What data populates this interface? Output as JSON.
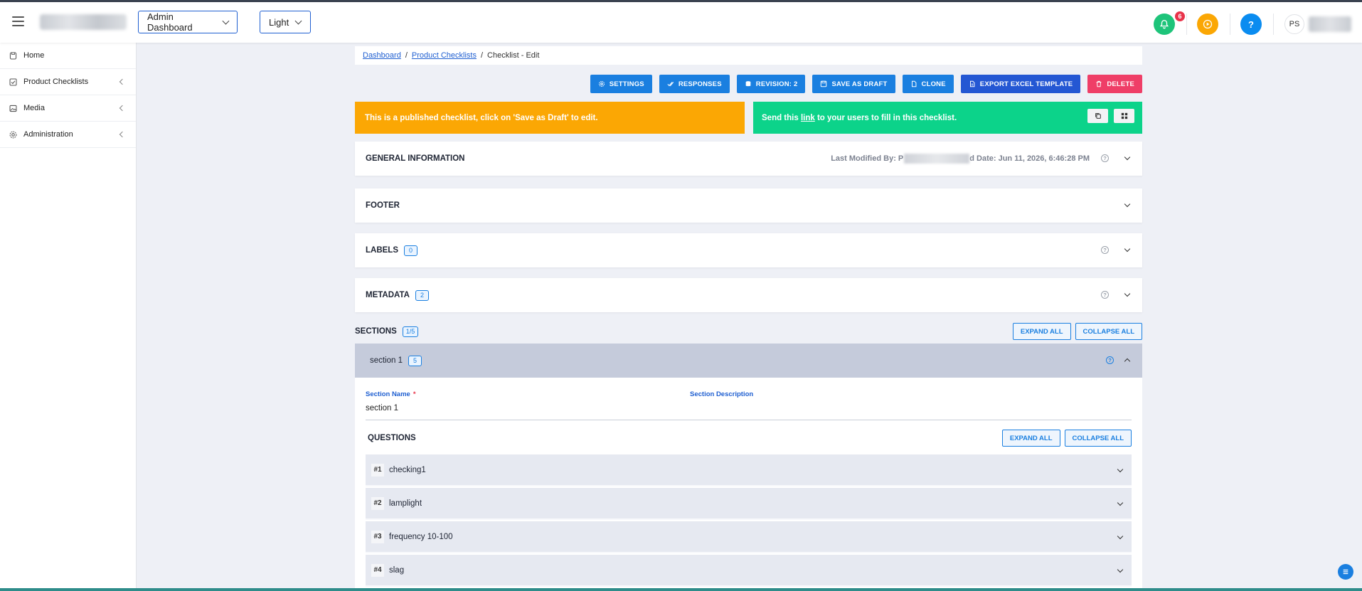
{
  "header": {
    "dashboard_select": "Admin Dashboard",
    "theme_select": "Light",
    "notification_count": "6",
    "help_label": "?",
    "avatar_initials": "PS"
  },
  "sidebar": {
    "items": [
      {
        "label": "Home",
        "icon": "home-icon"
      },
      {
        "label": "Product Checklists",
        "icon": "checklist-icon"
      },
      {
        "label": "Media",
        "icon": "image-icon"
      },
      {
        "label": "Administration",
        "icon": "gear-icon"
      }
    ]
  },
  "breadcrumb": {
    "item1": "Dashboard",
    "item2": "Product Checklists",
    "current": "Checklist - Edit",
    "separator": "/"
  },
  "toolbar": {
    "settings": "Settings",
    "responses": "Responses",
    "revision": "Revision: 2",
    "save_as_draft": "Save as draft",
    "clone": "Clone",
    "export": "Export Excel Template",
    "delete": "Delete"
  },
  "alerts": {
    "published": "This is a published checklist, click on 'Save as Draft' to edit.",
    "share_prefix": "Send this ",
    "share_link": "link",
    "share_suffix": " to your users to fill in this checklist."
  },
  "panels": {
    "general": "GENERAL INFORMATION",
    "last_modified_prefix": "Last Modified By: P",
    "last_modified_suffix": "d Date: Jun 11, 2026, 6:46:28 PM",
    "footer": "FOOTER",
    "labels": "LABELS",
    "labels_count": "0",
    "metadata": "METADATA",
    "metadata_count": "2"
  },
  "sections": {
    "title": "SECTIONS",
    "count": "1/5",
    "expand_all": "Expand all",
    "collapse_all": "Collapse all",
    "section_name": "section 1",
    "section_count": "5",
    "name_label": "Section Name",
    "required_mark": "*",
    "description_label": "Section Description",
    "name_value": "section 1",
    "questions_title": "QUESTIONS",
    "q_expand_all": "Expand all",
    "q_collapse_all": "Collapse all"
  },
  "questions": [
    {
      "num": "#1",
      "title": "checking1"
    },
    {
      "num": "#2",
      "title": "lamplight"
    },
    {
      "num": "#3",
      "title": "frequency 10-100"
    },
    {
      "num": "#4",
      "title": "slag"
    }
  ],
  "colors": {
    "primary": "#1a7fe0",
    "warning": "#fba704",
    "success": "#0cd38a",
    "danger": "#ef3e67",
    "notification": "#1ec47a",
    "help": "#0a8cf0",
    "play": "#fba704"
  }
}
